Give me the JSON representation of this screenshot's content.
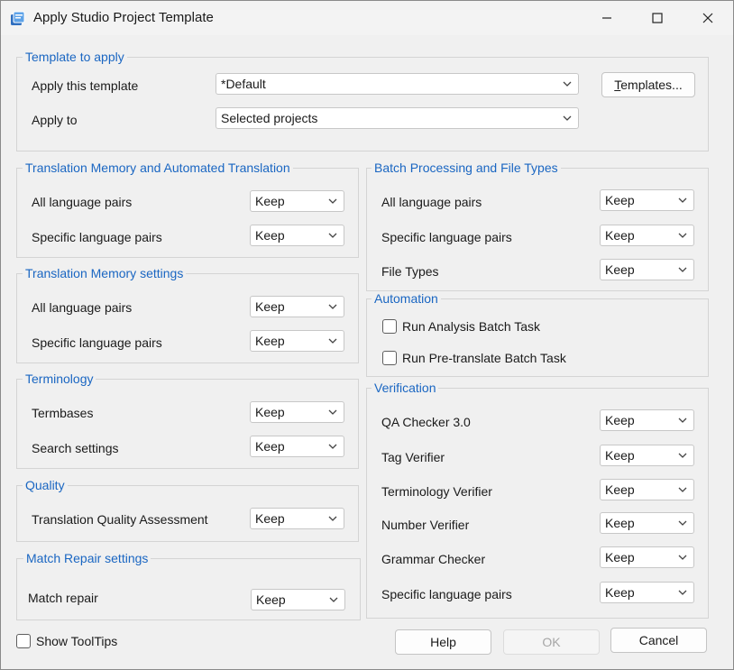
{
  "window": {
    "title": "Apply Studio Project Template"
  },
  "template_group": {
    "title": "Template to apply",
    "apply_template_label": "Apply this template",
    "apply_template_value": "*Default",
    "apply_to_label": "Apply to",
    "apply_to_value": "Selected projects",
    "templates_button_first": "T",
    "templates_button_rest": "emplates..."
  },
  "tm_group": {
    "title": "Translation Memory and Automated Translation",
    "rows": [
      {
        "label": "All language pairs",
        "value": "Keep"
      },
      {
        "label": "Specific language pairs",
        "value": "Keep"
      }
    ]
  },
  "tm_settings_group": {
    "title": "Translation Memory settings",
    "rows": [
      {
        "label": "All language pairs",
        "value": "Keep"
      },
      {
        "label": "Specific language pairs",
        "value": "Keep"
      }
    ]
  },
  "terminology_group": {
    "title": "Terminology",
    "rows": [
      {
        "label": "Termbases",
        "value": "Keep"
      },
      {
        "label": "Search settings",
        "value": "Keep"
      }
    ]
  },
  "quality_group": {
    "title": "Quality",
    "rows": [
      {
        "label": "Translation Quality Assessment",
        "value": "Keep"
      }
    ]
  },
  "match_repair_group": {
    "title": "Match Repair settings",
    "rows": [
      {
        "label": "Match repair",
        "value": "Keep"
      }
    ]
  },
  "batch_group": {
    "title": "Batch Processing and File Types",
    "rows": [
      {
        "label": "All language pairs",
        "value": "Keep"
      },
      {
        "label": "Specific language pairs",
        "value": "Keep"
      },
      {
        "label": "File Types",
        "value": "Keep"
      }
    ]
  },
  "automation_group": {
    "title": "Automation",
    "checkboxes": [
      {
        "label": "Run Analysis Batch Task",
        "checked": false
      },
      {
        "label": "Run Pre-translate Batch Task",
        "checked": false
      }
    ]
  },
  "verification_group": {
    "title": "Verification",
    "rows": [
      {
        "label": "QA Checker 3.0",
        "value": "Keep"
      },
      {
        "label": "Tag Verifier",
        "value": "Keep"
      },
      {
        "label": "Terminology Verifier",
        "value": "Keep"
      },
      {
        "label": "Number Verifier",
        "value": "Keep"
      },
      {
        "label": "Grammar Checker",
        "value": "Keep"
      },
      {
        "label": "Specific language pairs",
        "value": "Keep"
      }
    ]
  },
  "footer": {
    "show_tooltips_label": "Show ToolTips",
    "show_tooltips_checked": false,
    "help_label": "Help",
    "ok_label": "OK",
    "cancel_label": "Cancel"
  },
  "icons": {
    "app": "app-template-icon",
    "minimize": "minimize-icon",
    "maximize": "maximize-icon",
    "close": "close-icon",
    "dropdown": "chevron-down-icon"
  }
}
